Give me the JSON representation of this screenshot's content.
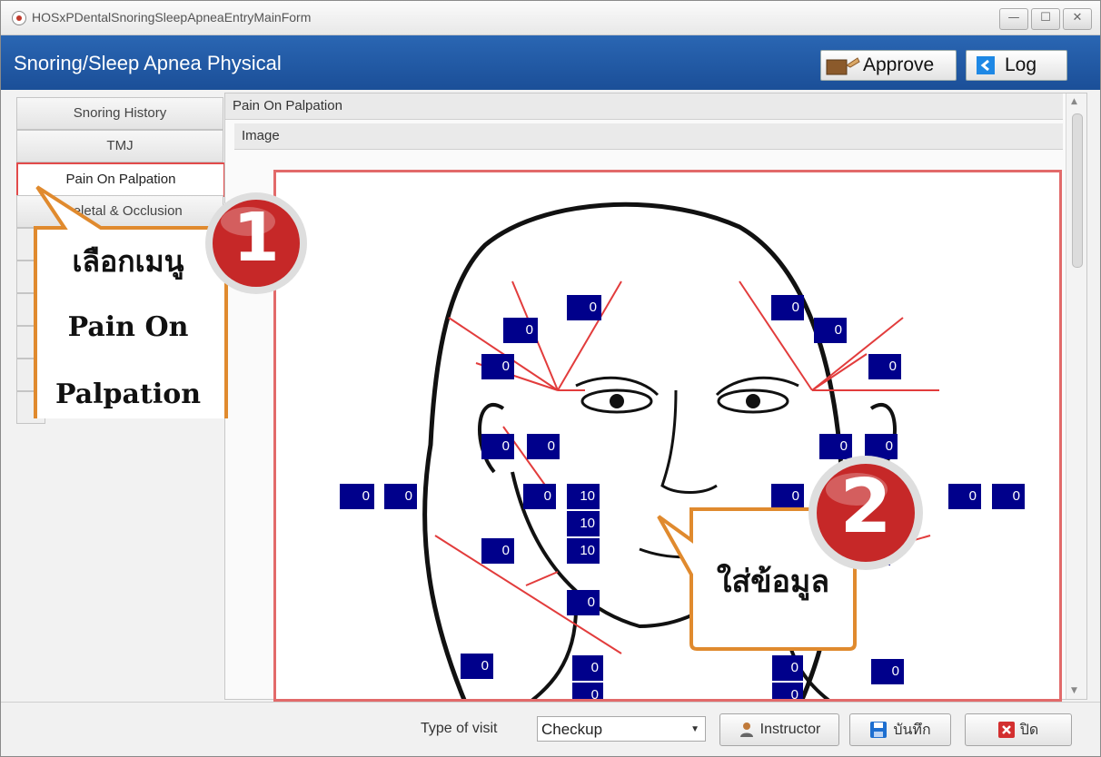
{
  "window": {
    "title": "HOSxPDentalSnoringSleepApneaEntryMainForm",
    "controls": {
      "minimize": "—",
      "maximize": "☐",
      "close": "✕"
    }
  },
  "header": {
    "title": "Snoring/Sleep Apnea Physical",
    "approve_label": "Approve",
    "log_label": "Log",
    "bg_color": "#1b4f98"
  },
  "sidebar": {
    "items": [
      {
        "label": "Snoring History"
      },
      {
        "label": "TMJ"
      },
      {
        "label": "Pain On Palpation"
      },
      {
        "label": "Skeletal & Occlusion"
      }
    ]
  },
  "main": {
    "section_title": "Pain On Palpation",
    "subsection_title": "Image",
    "values": {
      "v01": "0",
      "v02": "0",
      "v03": "0",
      "v04": "0",
      "v05": "0",
      "v06": "0",
      "v07": "0",
      "v08": "0",
      "v09": "0",
      "v10": "0",
      "v11": "0",
      "v12": "0",
      "v13": "0",
      "v14": "10",
      "v15": "10",
      "v16": "10",
      "v17": "0",
      "v18": "0",
      "v19": "0",
      "v20": "0",
      "v21": "0",
      "v22": "0",
      "v23": "0",
      "v24": "0",
      "v25": "0",
      "v26": "0",
      "v27": "0",
      "v28": "0",
      "v29": "0"
    }
  },
  "callouts": {
    "step1_number": "1",
    "step1_text_line1": "เลือกเมนู",
    "step1_text_line2": "Pain On",
    "step1_text_line3": "Palpation",
    "step2_number": "2",
    "step2_text": "ใส่ข้อมูล"
  },
  "footer": {
    "type_of_visit_label": "Type of visit",
    "type_of_visit_value": "Checkup",
    "instructor_label": "Instructor",
    "save_label": "บันทึก",
    "close_label": "ปิด"
  }
}
